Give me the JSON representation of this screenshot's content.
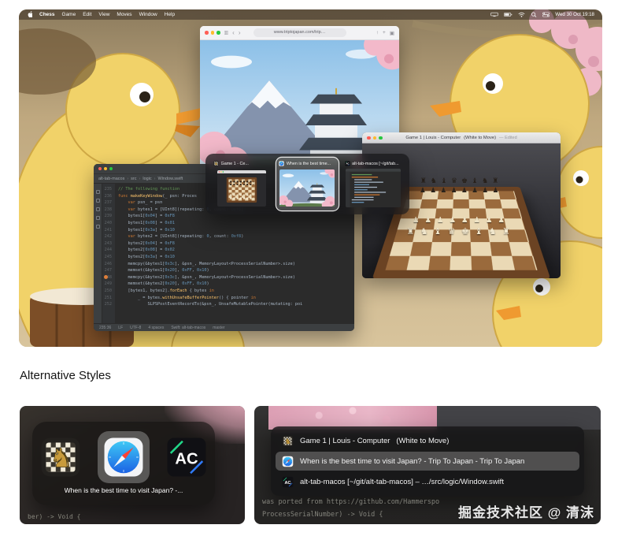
{
  "page": {
    "section_heading": "Alternative Styles",
    "watermark": "掘金技术社区 @ 清沫",
    "background": "#ffffff"
  },
  "menu_bar": {
    "app_name": "Chess",
    "menus": [
      "Game",
      "Edit",
      "View",
      "Moves",
      "Window",
      "Help"
    ],
    "clock": "Wed 30 Oct 19:18",
    "status_icons": [
      "display-icon",
      "battery-icon",
      "wifi-icon",
      "search-icon",
      "control-center-icon"
    ]
  },
  "safari_window": {
    "url": "www.triptojapan.com/trip…",
    "toolbar_icons": [
      "sidebar-icon",
      "back-button",
      "forward-button",
      "share-icon",
      "new-tab-icon",
      "tab-overview-icon"
    ]
  },
  "chess_window": {
    "title": "Game 1 | Louis - Computer",
    "state": "(White to Move)",
    "edited_label": "— Edited",
    "board_rows": [
      "♜♞♝♛♚♝♞♜",
      "♟♟♟♟♟♟♟♟",
      "♟♟♟♟♟♟♟♟",
      "♜♞♝♛♚♝♞♜"
    ]
  },
  "editor_window": {
    "title": "alt-tab-macos",
    "breadcrumb": [
      "alt-tab-macos",
      "src",
      "logic",
      "Window.swift"
    ],
    "first_line_number": 235,
    "breakpoint_line_index": 13,
    "status_items": [
      "235:36",
      "LF",
      "UTF-8",
      "4 spaces",
      "Swift: alt-tab-macos",
      "master"
    ],
    "code_lines": [
      [
        [
          "c",
          "// The following function"
        ]
      ],
      [
        [
          "k",
          "func "
        ],
        [
          "f",
          "makeKeyWindow"
        ],
        [
          "d",
          "(_ psn: Proces"
        ]
      ],
      [
        [
          "d",
          "    "
        ],
        [
          "k",
          "var "
        ],
        [
          "d",
          "psn_ = psn"
        ]
      ],
      [
        [
          "d",
          "    "
        ],
        [
          "k",
          "var "
        ],
        [
          "d",
          "bytes1 = [UInt8](repeating: "
        ],
        [
          "n",
          "0"
        ],
        [
          "d",
          ", count: "
        ],
        [
          "n",
          "0xf8"
        ],
        [
          "d",
          ")"
        ]
      ],
      [
        [
          "d",
          "    bytes1["
        ],
        [
          "n",
          "0x04"
        ],
        [
          "d",
          "] = "
        ],
        [
          "n",
          "0xF8"
        ]
      ],
      [
        [
          "d",
          "    bytes1["
        ],
        [
          "n",
          "0x08"
        ],
        [
          "d",
          "] = "
        ],
        [
          "n",
          "0x01"
        ]
      ],
      [
        [
          "d",
          "    bytes1["
        ],
        [
          "n",
          "0x3a"
        ],
        [
          "d",
          "] = "
        ],
        [
          "n",
          "0x10"
        ]
      ],
      [
        [
          "d",
          "    "
        ],
        [
          "k",
          "var "
        ],
        [
          "d",
          "bytes2 = [UInt8](repeating: "
        ],
        [
          "n",
          "0"
        ],
        [
          "d",
          ", count: "
        ],
        [
          "n",
          "0xf8"
        ],
        [
          "d",
          ")"
        ]
      ],
      [
        [
          "d",
          "    bytes2["
        ],
        [
          "n",
          "0x04"
        ],
        [
          "d",
          "] = "
        ],
        [
          "n",
          "0xF8"
        ]
      ],
      [
        [
          "d",
          "    bytes2["
        ],
        [
          "n",
          "0x08"
        ],
        [
          "d",
          "] = "
        ],
        [
          "n",
          "0x02"
        ]
      ],
      [
        [
          "d",
          "    bytes2["
        ],
        [
          "n",
          "0x3a"
        ],
        [
          "d",
          "] = "
        ],
        [
          "n",
          "0x10"
        ]
      ],
      [
        [
          "d",
          "    memcpy(&bytes1["
        ],
        [
          "n",
          "0x3c"
        ],
        [
          "d",
          "], &psn_, MemoryLayout<ProcessSerialNumber>.size)"
        ]
      ],
      [
        [
          "d",
          "    memset(&bytes1["
        ],
        [
          "n",
          "0x20"
        ],
        [
          "d",
          "], "
        ],
        [
          "n",
          "0xFF"
        ],
        [
          "d",
          ", "
        ],
        [
          "n",
          "0x10"
        ],
        [
          "d",
          ")"
        ]
      ],
      [
        [
          "d",
          "    memcpy(&bytes2["
        ],
        [
          "n",
          "0x3c"
        ],
        [
          "d",
          "], &psn_, MemoryLayout<ProcessSerialNumber>.size)"
        ]
      ],
      [
        [
          "d",
          "    memset(&bytes2["
        ],
        [
          "n",
          "0x20"
        ],
        [
          "d",
          "], "
        ],
        [
          "n",
          "0xFF"
        ],
        [
          "d",
          ", "
        ],
        [
          "n",
          "0x10"
        ],
        [
          "d",
          ")"
        ]
      ],
      [
        [
          "d",
          "    [bytes1, bytes2]."
        ],
        [
          "f",
          "forEach"
        ],
        [
          "d",
          " { bytes "
        ],
        [
          "k",
          "in"
        ]
      ],
      [
        [
          "d",
          "        _ = bytes."
        ],
        [
          "f",
          "withUnsafeBufferPointer"
        ],
        [
          "d",
          "() { pointer "
        ],
        [
          "k",
          "in"
        ]
      ],
      [
        [
          "d",
          "            SLPSPostEventRecordTo(&psn_, UnsafeMutablePointer(mutating: poi"
        ]
      ]
    ]
  },
  "switcher": {
    "items": [
      {
        "app": "chess",
        "label": "Game 1 - Ce...",
        "selected": false
      },
      {
        "app": "safari",
        "label": "When is the best time...",
        "selected": true
      },
      {
        "app": "appcode",
        "label": "alt-tab-macos [~/git/tab...",
        "selected": false
      }
    ]
  },
  "app_icons_style": {
    "items": [
      {
        "app": "chess",
        "selected": false
      },
      {
        "app": "safari",
        "selected": true
      },
      {
        "app": "appcode",
        "selected": false
      }
    ],
    "caption": "When is the best time to visit Japan? -...",
    "background_code_line": "ber) -> Void {"
  },
  "window_titles_style": {
    "rows": [
      {
        "app": "chess",
        "label": "Game 1 | Louis - Computer   (White to Move)",
        "selected": false
      },
      {
        "app": "safari",
        "label": "When is the best time to visit Japan? - Trip To Japan - Trip To Japan",
        "selected": true
      },
      {
        "app": "appcode",
        "label": "alt-tab-macos [~/git/alt-tab-macos] – …/src/logic/Window.swift",
        "selected": false
      }
    ],
    "background_code_lines": [
      "was ported from https://github.com/Hammerspo",
      "ProcessSerialNumber) -> Void {"
    ]
  },
  "colors": {
    "selection_highlight": "#ffffff",
    "keyword": "#cc7832",
    "number": "#6897bb",
    "comment": "#629755",
    "function": "#ffc66d",
    "code_default": "#a9b7c6",
    "traffic_red": "#ff5f57",
    "traffic_yellow": "#febc2e",
    "traffic_green": "#28c840"
  }
}
